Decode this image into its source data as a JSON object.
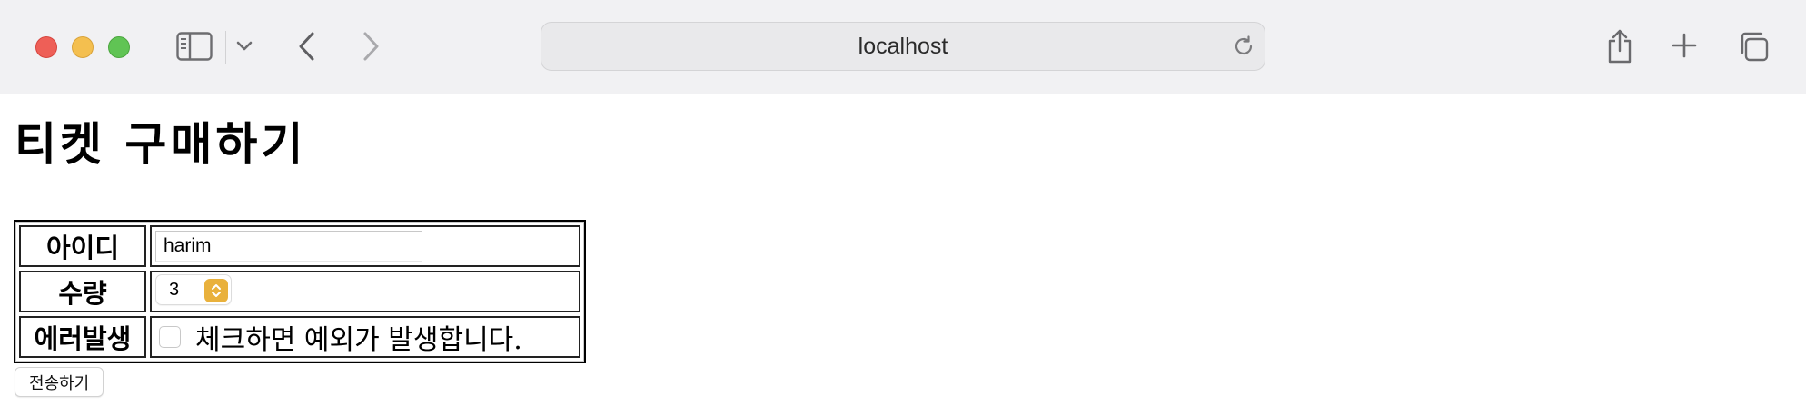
{
  "browser": {
    "url": "localhost",
    "icons": {
      "close": "traffic-light-red",
      "minimize": "traffic-light-yellow",
      "zoom": "traffic-light-green",
      "sidebar": "sidebar-icon",
      "sidebar_menu": "chevron-down-icon",
      "back": "chevron-left-icon",
      "forward": "chevron-right-icon",
      "reload": "reload-icon",
      "share": "share-icon",
      "new_tab": "plus-icon",
      "tab_overview": "tabs-icon"
    },
    "colors": {
      "close": "#ee5f57",
      "minimize": "#f4bf4f",
      "zoom": "#60c454",
      "stepper_accent": "#e9b13c"
    }
  },
  "page": {
    "title": "티켓 구매하기",
    "form": {
      "id_label": "아이디",
      "id_value": "harim",
      "quantity_label": "수량",
      "quantity_value": "3",
      "error_label": "에러발생",
      "error_checkbox_checked": false,
      "error_checkbox_text": "체크하면 예외가 발생합니다.",
      "submit_label": "전송하기"
    }
  }
}
